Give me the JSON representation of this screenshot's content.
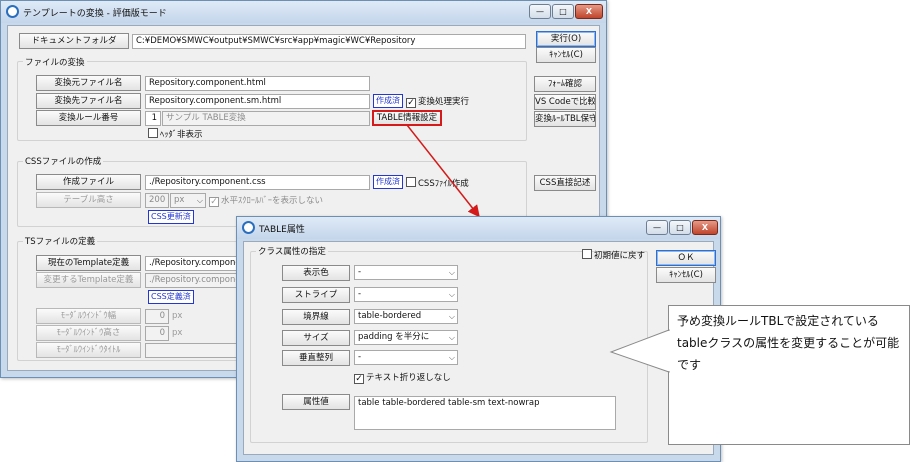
{
  "main": {
    "title": "テンプレートの変換 - 評価版モード",
    "window_buttons": {
      "min": "—",
      "max": "□",
      "close": "X"
    },
    "doc_folder_label": "ドキュメントフォルダ",
    "doc_folder_path": "C:¥DEMO¥SMWC¥output¥SMWC¥src¥app¥magic¥WC¥Repository",
    "run_button": "実行(O)",
    "cancel_button": "ｷｬﾝｾﾙ(C)",
    "file_convert_group": "ファイルの変換",
    "src_file_label": "変換元ファイル名",
    "src_file_value": "Repository.component.html",
    "dst_file_label": "変換先ファイル名",
    "dst_file_value": "Repository.component.sm.html",
    "created_badge": "作成済",
    "convert_exec_check": "変換処理実行",
    "rule_no_label": "変換ルール番号",
    "rule_no_value": "1",
    "rule_name_value": "サンプル TABLE変換",
    "table_info_button": "TABLE情報設定",
    "header_hide_check": "ﾍｯﾀﾞ非表示",
    "form_check_button": "ﾌｫｰﾑ確認",
    "vscode_compare_button": "VS Codeで比較",
    "rule_tbl_save_button": "変換ﾙｰﾙTBL保守",
    "css_group": "CSSファイルの作成",
    "css_create_label": "作成ファイル",
    "css_file_value": "./Repository.component.css",
    "css_created_badge": "作成済",
    "css_create_check": "CSSﾌｧｲﾙ作成",
    "table_height_label": "テーブル高さ",
    "table_height_value": "200",
    "table_height_unit": "px",
    "hscroll_check": "水平ｽｸﾛｰﾙﾊﾞｰを表示しない",
    "css_updated_badge": "CSS更新済",
    "css_direct_button": "CSS直接記述",
    "ts_group": "TSファイルの定義",
    "cur_template_label": "現在のTemplate定義",
    "cur_template_value": "./Repository.component",
    "change_template_label": "変更するTemplate定義",
    "change_template_value": "./Repository.component",
    "css_defined_badge": "CSS定義済",
    "modal_width_label": "ﾓｰﾀﾞﾙｳｲﾝﾄﾞｳ幅",
    "modal_width_value": "0",
    "modal_height_label": "ﾓｰﾀﾞﾙｳｲﾝﾄﾞｳ高さ",
    "modal_height_value": "0",
    "px_unit": "px",
    "modal_title_label": "ﾓｰﾀﾞﾙｳｲﾝﾄﾞｳﾀｲﾄﾙ"
  },
  "dialog": {
    "title": "TABLE属性",
    "group": "クラス属性の指定",
    "reset_check": "初期値に戻す",
    "ok_button": "ＯＫ",
    "cancel_button": "ｷｬﾝｾﾙ(C)",
    "display_color_label": "表示色",
    "display_color_value": "-",
    "stripe_label": "ストライプ",
    "stripe_value": "-",
    "border_label": "境界線",
    "border_value": "table-bordered",
    "size_label": "サイズ",
    "size_value": "padding を半分に",
    "valign_label": "垂直整列",
    "valign_value": "-",
    "nowrap_check": "テキスト折り返しなし",
    "attr_label": "属性値",
    "attr_value": "table table-bordered table-sm text-nowrap"
  },
  "callout": {
    "text": "予め変換ルールTBLで設定されているtableクラスの属性を変更することが可能です"
  },
  "colors": {
    "highlight": "#d41a1a",
    "badge": "#2438d1",
    "titlebar": "#c4d6ec"
  }
}
